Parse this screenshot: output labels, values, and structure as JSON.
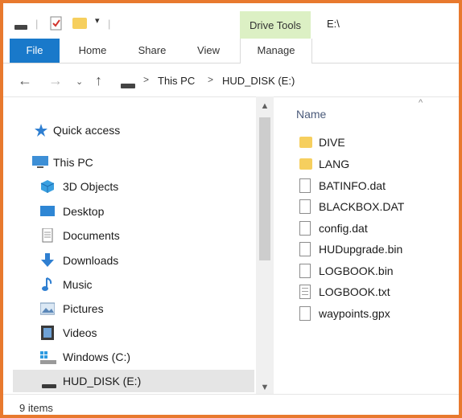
{
  "window": {
    "title": "E:\\",
    "drive_tools_label": "Drive Tools"
  },
  "ribbon": {
    "tabs": [
      {
        "label": "File"
      },
      {
        "label": "Home"
      },
      {
        "label": "Share"
      },
      {
        "label": "View"
      },
      {
        "label": "Manage"
      }
    ]
  },
  "address_bar": {
    "breadcrumbs": [
      "This PC",
      "HUD_DISK (E:)"
    ],
    "separator": ">"
  },
  "navigation": {
    "quick_access": "Quick access",
    "this_pc": "This PC",
    "items": [
      {
        "label": "3D Objects",
        "icon": "3d-objects-icon"
      },
      {
        "label": "Desktop",
        "icon": "desktop-icon"
      },
      {
        "label": "Documents",
        "icon": "documents-icon"
      },
      {
        "label": "Downloads",
        "icon": "downloads-icon"
      },
      {
        "label": "Music",
        "icon": "music-icon"
      },
      {
        "label": "Pictures",
        "icon": "pictures-icon"
      },
      {
        "label": "Videos",
        "icon": "videos-icon"
      },
      {
        "label": "Windows (C:)",
        "icon": "windows-drive-icon"
      },
      {
        "label": "HUD_DISK (E:)",
        "icon": "usb-drive-icon",
        "selected": true
      }
    ]
  },
  "file_list": {
    "column_name": "Name",
    "files": [
      {
        "name": "DIVE",
        "type": "folder"
      },
      {
        "name": "LANG",
        "type": "folder"
      },
      {
        "name": "BATINFO.dat",
        "type": "file"
      },
      {
        "name": "BLACKBOX.DAT",
        "type": "file"
      },
      {
        "name": "config.dat",
        "type": "file"
      },
      {
        "name": "HUDupgrade.bin",
        "type": "file"
      },
      {
        "name": "LOGBOOK.bin",
        "type": "file"
      },
      {
        "name": "LOGBOOK.txt",
        "type": "text"
      },
      {
        "name": "waypoints.gpx",
        "type": "file"
      }
    ]
  },
  "status_bar": {
    "item_count": "9 items"
  },
  "colors": {
    "accent": "#1979ca",
    "drive_tools": "#dcf0c4",
    "folder": "#f6cf5e",
    "frame": "#e8792e"
  }
}
